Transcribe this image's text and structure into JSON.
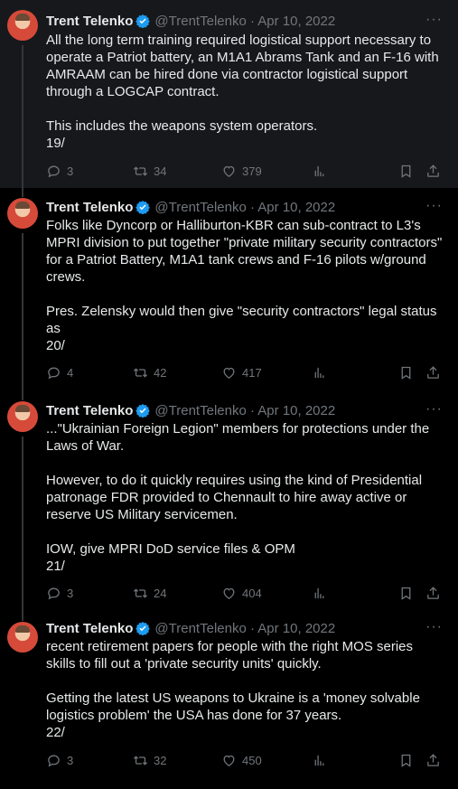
{
  "colors": {
    "background": "#000000",
    "text": "#e7e9ea",
    "muted": "#71767b",
    "verified": "#1d9bf0"
  },
  "tweets": [
    {
      "name": "Trent Telenko",
      "handle_time": "@TrentTelenko · Apr 10, 2022",
      "text": "All the long term training required logistical support necessary to operate a Patriot battery, an M1A1 Abrams Tank and an F-16 with AMRAAM can be hired done via contractor logistical support through a LOGCAP contract.\n\nThis includes the weapons system operators.\n19/",
      "replies": "3",
      "retweets": "34",
      "likes": "379"
    },
    {
      "name": "Trent Telenko",
      "handle_time": "@TrentTelenko · Apr 10, 2022",
      "text": "Folks like Dyncorp or Halliburton-KBR can sub-contract to L3's MPRI division to put together \"private military security contractors\" for a Patriot Battery, M1A1 tank crews and F-16 pilots w/ground crews.\n\nPres. Zelensky would then give \"security contractors\" legal status as\n20/",
      "replies": "4",
      "retweets": "42",
      "likes": "417"
    },
    {
      "name": "Trent Telenko",
      "handle_time": "@TrentTelenko · Apr 10, 2022",
      "text": "...\"Ukrainian Foreign Legion\" members for protections under the Laws of War.\n\nHowever, to do it quickly requires using the kind of Presidential patronage FDR provided to Chennault to hire away active or reserve US Military servicemen.\n\nIOW, give MPRI DoD service files & OPM\n21/",
      "replies": "3",
      "retweets": "24",
      "likes": "404"
    },
    {
      "name": "Trent Telenko",
      "handle_time": "@TrentTelenko · Apr 10, 2022",
      "text": "recent retirement papers for people with the right MOS series skills to fill out a 'private security units' quickly.\n\nGetting the latest US weapons to Ukraine is a 'money solvable logistics problem' the USA has done for 37 years.\n22/",
      "replies": "3",
      "retweets": "32",
      "likes": "450"
    }
  ]
}
